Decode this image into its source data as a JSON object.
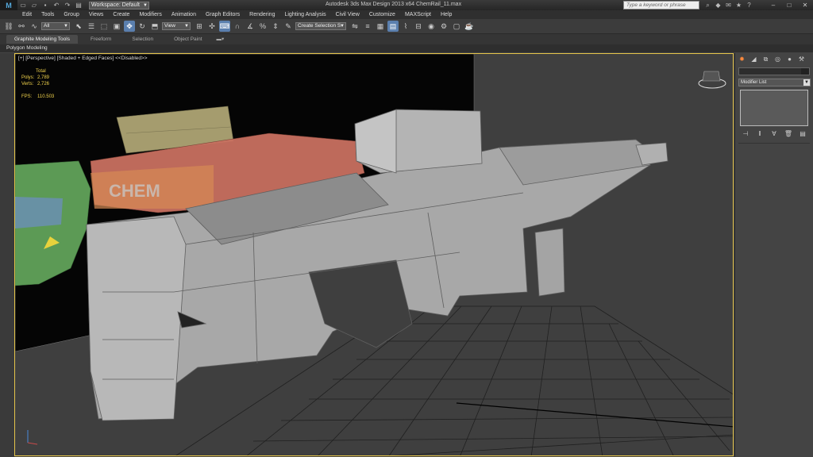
{
  "titlebar": {
    "logo": "M",
    "workspace": "Workspace: Default",
    "title": "Autodesk 3ds Max Design 2013 x64     ChemRail_11.max",
    "search_placeholder": "Type a keyword or phrase"
  },
  "menu": [
    "Edit",
    "Tools",
    "Group",
    "Views",
    "Create",
    "Modifiers",
    "Animation",
    "Graph Editors",
    "Rendering",
    "Lighting Analysis",
    "Civil View",
    "Customize",
    "MAXScript",
    "Help"
  ],
  "toolbar": {
    "filter": "All",
    "coord": "View",
    "selection_set": "Create Selection S"
  },
  "ribbon": {
    "tabs": [
      "Graphite Modeling Tools",
      "Freeform",
      "Selection",
      "Object Paint"
    ],
    "sub": "Polygon Modeling"
  },
  "viewport": {
    "label": "[+] [Perspective] [Shaded + Edged Faces] <<Disabled>>",
    "stats": {
      "total_label": "Total",
      "polys_label": "Polys:",
      "polys": "2,789",
      "verts_label": "Verts:",
      "verts": "2,726",
      "fps_label": "FPS:",
      "fps": "110.503"
    },
    "texture_text": "CHEM"
  },
  "command_panel": {
    "modifier_list": "Modifier List"
  },
  "colors": {
    "accent": "#5a7fae",
    "viewport_border": "#e4c44a",
    "stats_text": "#f2d44c",
    "model_gray": "#a8a8a8"
  }
}
